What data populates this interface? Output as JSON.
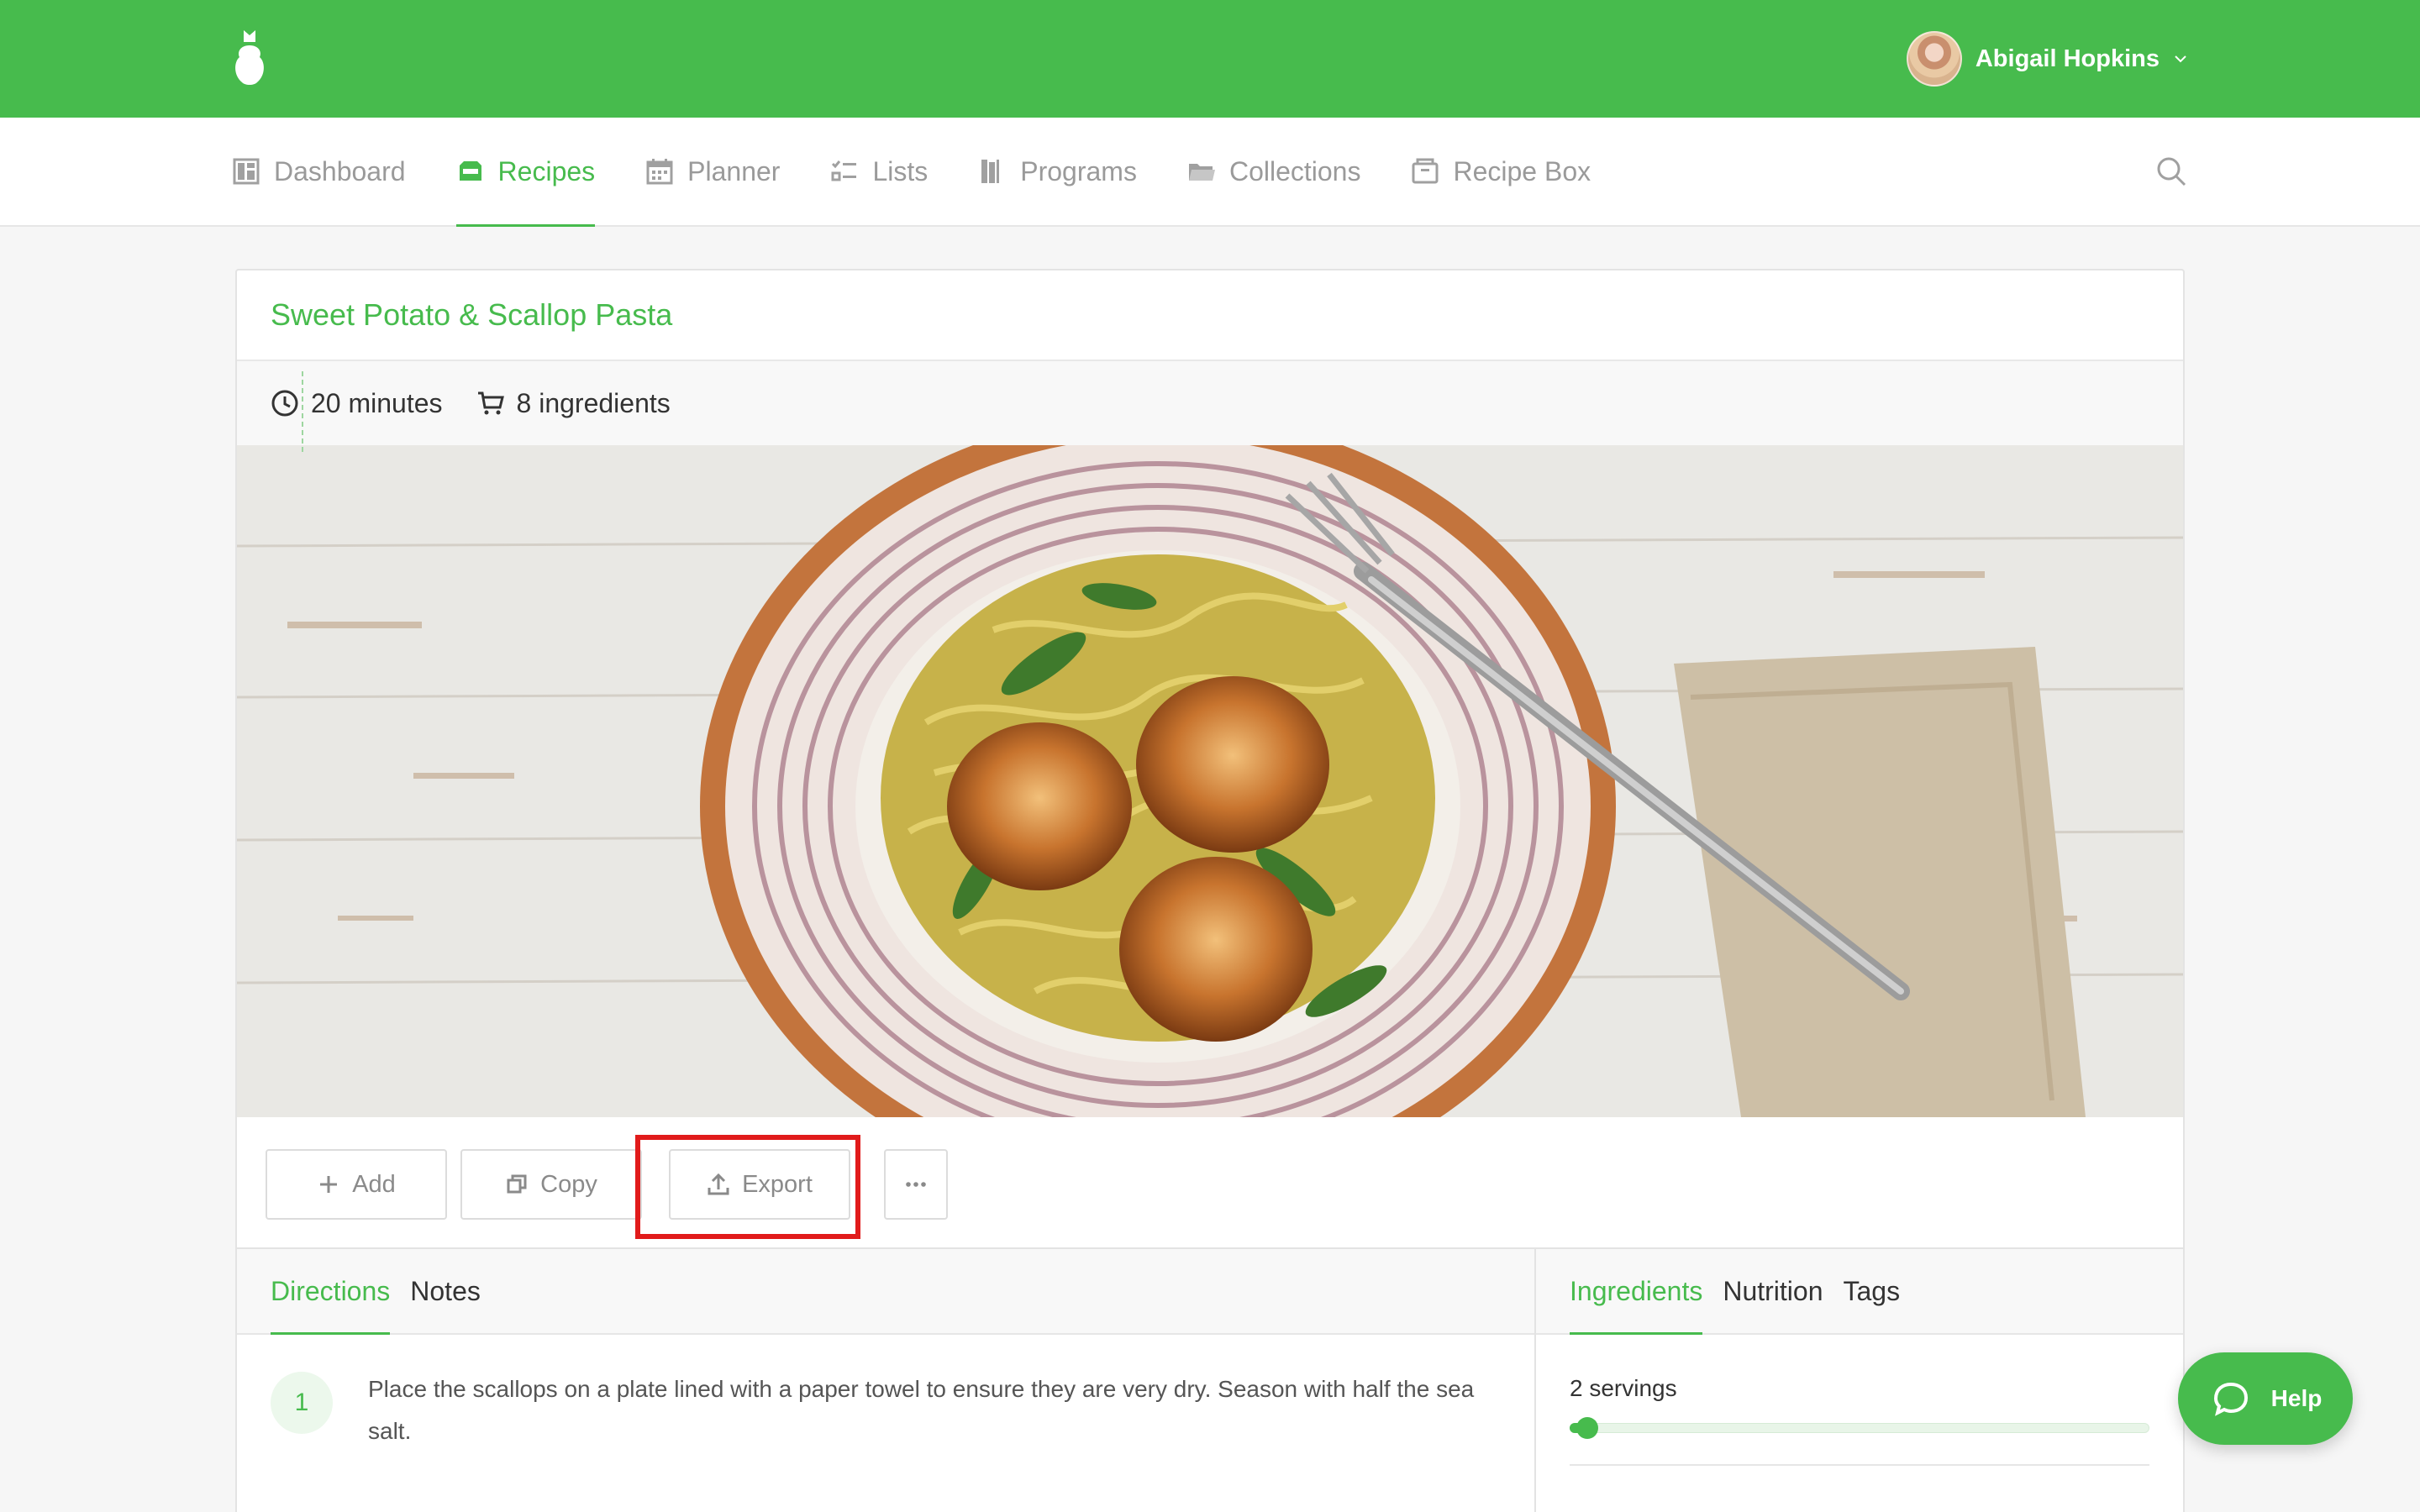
{
  "theme": {
    "brand": "#47bb4d",
    "highlight": "#e11b1b"
  },
  "header": {
    "logo_icon": "app-logo-icon",
    "user": {
      "name": "Abigail Hopkins",
      "menu_icon": "chevron-down-icon"
    }
  },
  "nav": {
    "items": [
      {
        "label": "Dashboard",
        "icon": "dashboard-icon",
        "active": false
      },
      {
        "label": "Recipes",
        "icon": "recipes-icon",
        "active": true
      },
      {
        "label": "Planner",
        "icon": "calendar-icon",
        "active": false
      },
      {
        "label": "Lists",
        "icon": "checklist-icon",
        "active": false
      },
      {
        "label": "Programs",
        "icon": "programs-icon",
        "active": false
      },
      {
        "label": "Collections",
        "icon": "folder-icon",
        "active": false
      },
      {
        "label": "Recipe Box",
        "icon": "recipe-box-icon",
        "active": false
      }
    ],
    "search_icon": "search-icon"
  },
  "recipe": {
    "title": "Sweet Potato & Scallop Pasta",
    "time": "20 minutes",
    "ingredients_count": "8 ingredients"
  },
  "actions": {
    "add": "Add",
    "copy": "Copy",
    "export": "Export",
    "more_icon": "more-icon"
  },
  "left_tabs": [
    {
      "label": "Directions",
      "active": true
    },
    {
      "label": "Notes",
      "active": false
    }
  ],
  "right_tabs": [
    {
      "label": "Ingredients",
      "active": true
    },
    {
      "label": "Nutrition",
      "active": false
    },
    {
      "label": "Tags",
      "active": false
    }
  ],
  "directions": [
    {
      "number": "1",
      "text": "Place the scallops on a plate lined with a paper towel to ensure they are very dry. Season with half the sea salt."
    }
  ],
  "servings": {
    "label": "2 servings",
    "level": 0.03
  },
  "help": {
    "label": "Help",
    "icon": "chat-bubble-icon"
  }
}
